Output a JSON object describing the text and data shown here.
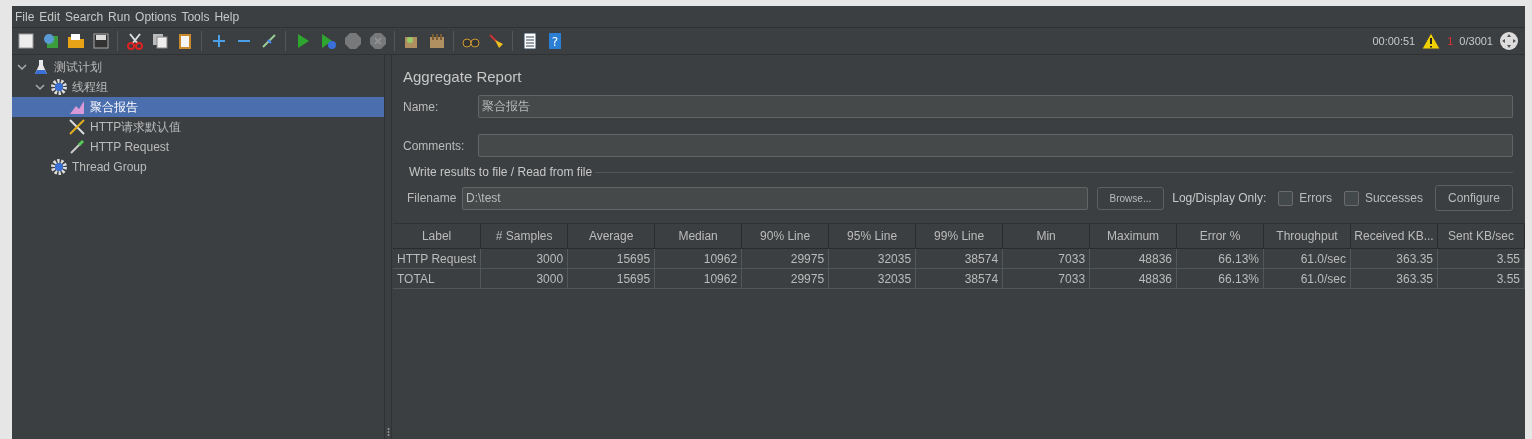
{
  "menu": [
    "File",
    "Edit",
    "Search",
    "Run",
    "Options",
    "Tools",
    "Help"
  ],
  "toolbar": [
    {
      "kind": "new",
      "disabled": false
    },
    {
      "kind": "templates",
      "disabled": false
    },
    {
      "kind": "open",
      "disabled": false
    },
    {
      "kind": "save",
      "disabled": false
    },
    {
      "kind": "sep"
    },
    {
      "kind": "cut",
      "disabled": false
    },
    {
      "kind": "copy",
      "disabled": false
    },
    {
      "kind": "paste",
      "disabled": false
    },
    {
      "kind": "sep"
    },
    {
      "kind": "expand",
      "disabled": false
    },
    {
      "kind": "collapse",
      "disabled": false
    },
    {
      "kind": "toggle",
      "disabled": false
    },
    {
      "kind": "sep"
    },
    {
      "kind": "start",
      "disabled": false
    },
    {
      "kind": "start-no-timers",
      "disabled": false
    },
    {
      "kind": "stop",
      "disabled": true
    },
    {
      "kind": "shutdown",
      "disabled": true
    },
    {
      "kind": "sep"
    },
    {
      "kind": "clear",
      "disabled": false
    },
    {
      "kind": "clear-all",
      "disabled": false
    },
    {
      "kind": "sep"
    },
    {
      "kind": "search",
      "disabled": false
    },
    {
      "kind": "reset-search",
      "disabled": false
    },
    {
      "kind": "sep"
    },
    {
      "kind": "functions",
      "disabled": false
    },
    {
      "kind": "help",
      "disabled": false,
      "glyph": "?"
    }
  ],
  "status": {
    "elapsed": "00:00:51",
    "error_count": "1",
    "threads": "0/3001"
  },
  "tree": [
    {
      "label": "测试计划",
      "kind": "plan",
      "selected": false,
      "expanded": true,
      "children": [
        {
          "label": "线程组",
          "kind": "group",
          "selected": false,
          "expanded": true,
          "children": [
            {
              "label": "聚合报告",
              "kind": "listener",
              "selected": true
            },
            {
              "label": "HTTP请求默认值",
              "kind": "config",
              "selected": false
            },
            {
              "label": "HTTP Request",
              "kind": "sampler",
              "selected": false
            }
          ]
        },
        {
          "label": "Thread Group",
          "kind": "group",
          "selected": false
        }
      ]
    }
  ],
  "panel": {
    "title": "Aggregate Report",
    "name_label": "Name:",
    "name_value": "聚合报告",
    "comments_label": "Comments:",
    "file_section": "Write results to file / Read from file",
    "filename_label": "Filename",
    "filename_value": "D:\\test",
    "browse": "Browse...",
    "log_label": "Log/Display Only:",
    "errors": {
      "label": "Errors",
      "checked": false
    },
    "successes": {
      "label": "Successes",
      "checked": false
    },
    "configure": "Configure"
  },
  "table": {
    "columns": [
      "Label",
      "# Samples",
      "Average",
      "Median",
      "90% Line",
      "95% Line",
      "99% Line",
      "Min",
      "Maximum",
      "Error %",
      "Throughput",
      "Received KB...",
      "Sent KB/sec"
    ],
    "rows": [
      [
        "HTTP Request",
        "3000",
        "15695",
        "10962",
        "29975",
        "32035",
        "38574",
        "7033",
        "48836",
        "66.13%",
        "61.0/sec",
        "363.35",
        "3.55"
      ],
      [
        "TOTAL",
        "3000",
        "15695",
        "10962",
        "29975",
        "32035",
        "38574",
        "7033",
        "48836",
        "66.13%",
        "61.0/sec",
        "363.35",
        "3.55"
      ]
    ]
  }
}
